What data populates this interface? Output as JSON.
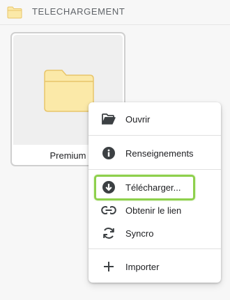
{
  "header": {
    "title": "TELECHARGEMENT",
    "icon": "folder-icon"
  },
  "tile": {
    "name": "Premium",
    "icon": "folder-icon"
  },
  "menu": {
    "items": [
      {
        "label": "Ouvrir",
        "icon": "folder-open-icon"
      },
      {
        "label": "Renseignements",
        "icon": "info-icon"
      },
      {
        "label": "Télécharger...",
        "icon": "download-icon"
      },
      {
        "label": "Obtenir le lien",
        "icon": "link-icon"
      },
      {
        "label": "Syncro",
        "icon": "sync-icon"
      },
      {
        "label": "Importer",
        "icon": "add-icon"
      }
    ]
  },
  "colors": {
    "highlight": "#8ed04c",
    "folder_fill": "#fbe9a8",
    "folder_stroke": "#e8c56a"
  }
}
